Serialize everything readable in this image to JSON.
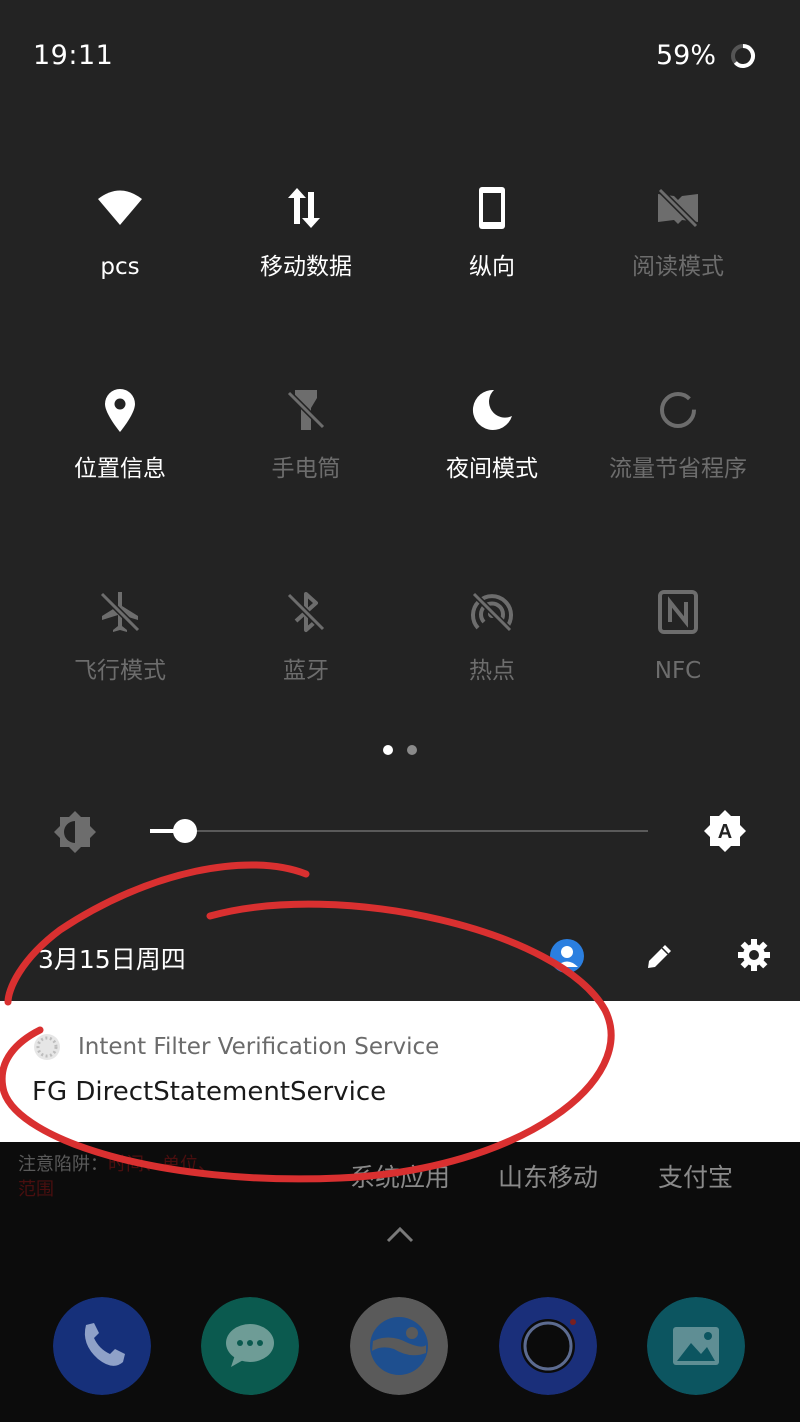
{
  "status_bar": {
    "time": "19:11",
    "battery": "59%"
  },
  "quick_settings": {
    "row1": [
      {
        "label": "pcs",
        "icon": "wifi-icon",
        "state": "on"
      },
      {
        "label": "移动数据",
        "icon": "mobile-data-icon",
        "state": "on"
      },
      {
        "label": "纵向",
        "icon": "portrait-phone-icon",
        "state": "on"
      },
      {
        "label": "阅读模式",
        "icon": "reading-mode-icon",
        "state": "off"
      }
    ],
    "row2": [
      {
        "label": "位置信息",
        "icon": "location-icon",
        "state": "on"
      },
      {
        "label": "手电筒",
        "icon": "flashlight-icon",
        "state": "off"
      },
      {
        "label": "夜间模式",
        "icon": "moon-icon",
        "state": "on"
      },
      {
        "label": "流量节省程序",
        "icon": "data-saver-icon",
        "state": "off"
      }
    ],
    "row3": [
      {
        "label": "飞行模式",
        "icon": "airplane-icon",
        "state": "off"
      },
      {
        "label": "蓝牙",
        "icon": "bluetooth-icon",
        "state": "off"
      },
      {
        "label": "热点",
        "icon": "hotspot-icon",
        "state": "off"
      },
      {
        "label": "NFC",
        "icon": "nfc-icon",
        "state": "off"
      }
    ],
    "page_count": 2,
    "current_page": 1
  },
  "brightness": {
    "level": 0.07,
    "auto": true
  },
  "footer": {
    "date": "3月15日周四"
  },
  "notification": {
    "app_name": "Intent Filter Verification Service",
    "text": "FG DirectStatementService"
  },
  "background": {
    "warning_prefix": "注意陷阱：",
    "warning_red1": "时间、单位、",
    "warning_red2": "范围",
    "app_labels": [
      "系统应用",
      "山东移动",
      "支付宝"
    ]
  },
  "colors": {
    "panel_bg": "#232323",
    "active": "#ffffff",
    "inactive": "#6d6d6d",
    "account_blue": "#2b7fe0",
    "annotation_red": "#d93030"
  }
}
